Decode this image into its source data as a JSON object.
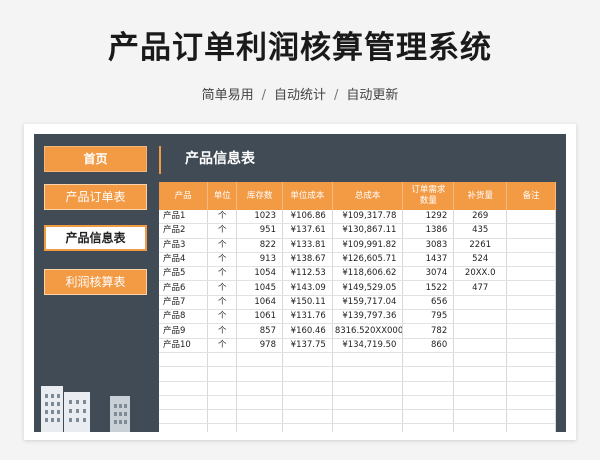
{
  "header": {
    "title": "产品订单利润核算管理系统",
    "tags": [
      "简单易用",
      "自动统计",
      "自动更新"
    ],
    "separator": "/"
  },
  "sidebar": {
    "items": [
      {
        "label": "首页",
        "state": "home"
      },
      {
        "label": "产品订单表",
        "state": "normal"
      },
      {
        "label": "产品信息表",
        "state": "active"
      },
      {
        "label": "利润核算表",
        "state": "normal"
      }
    ]
  },
  "main": {
    "section_title": "产品信息表",
    "table": {
      "columns": [
        "产品",
        "单位",
        "库存数",
        "单位成本",
        "总成本",
        "订单需求\n数量",
        "补货量",
        "备注"
      ],
      "rows": [
        [
          "产品1",
          "个",
          "1023",
          "¥106.86",
          "¥109,317.78",
          "1292",
          "269",
          ""
        ],
        [
          "产品2",
          "个",
          "951",
          "¥137.61",
          "¥130,867.11",
          "1386",
          "435",
          ""
        ],
        [
          "产品3",
          "个",
          "822",
          "¥133.81",
          "¥109,991.82",
          "3083",
          "2261",
          ""
        ],
        [
          "产品4",
          "个",
          "913",
          "¥138.67",
          "¥126,605.71",
          "1437",
          "524",
          ""
        ],
        [
          "产品5",
          "个",
          "1054",
          "¥112.53",
          "¥118,606.62",
          "3074",
          "20XX.0",
          ""
        ],
        [
          "产品6",
          "个",
          "1045",
          "¥143.09",
          "¥149,529.05",
          "1522",
          "477",
          ""
        ],
        [
          "产品7",
          "个",
          "1064",
          "¥150.11",
          "¥159,717.04",
          "656",
          "",
          ""
        ],
        [
          "产品8",
          "个",
          "1061",
          "¥131.76",
          "¥139,797.36",
          "795",
          "",
          ""
        ],
        [
          "产品9",
          "个",
          "857",
          "¥160.46",
          "8316.520XX0000",
          "782",
          "",
          ""
        ],
        [
          "产品10",
          "个",
          "978",
          "¥137.75",
          "¥134,719.50",
          "860",
          "",
          ""
        ]
      ],
      "empty_rows": 6
    }
  },
  "colors": {
    "accent": "#f39a45",
    "panel": "#414b55",
    "title": "#1a1a1a"
  }
}
